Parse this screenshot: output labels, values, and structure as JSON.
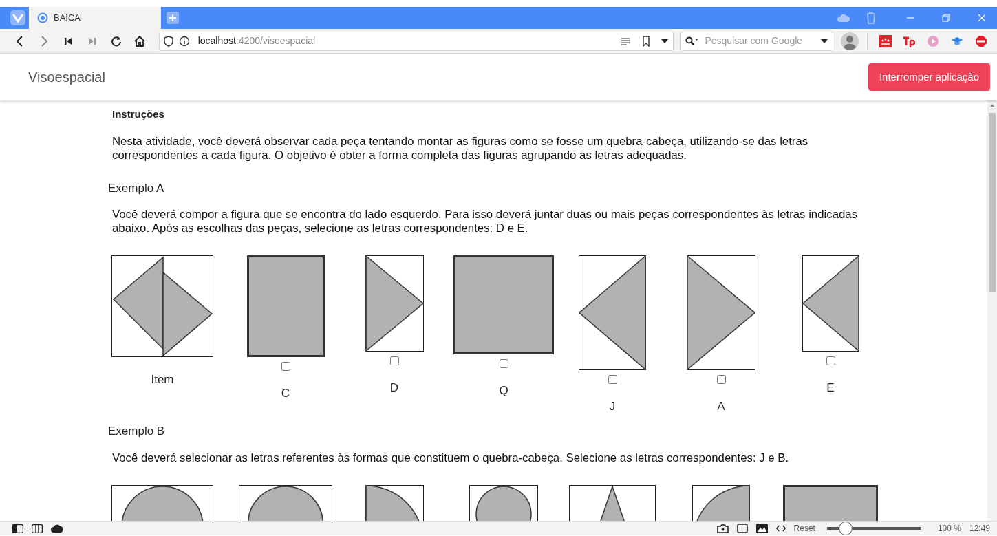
{
  "browser": {
    "tab": {
      "title": "BAICA",
      "selected": true
    },
    "address": {
      "host": "localhost",
      "path": ":4200/visoespacial"
    },
    "search": {
      "placeholder": "Pesquisar com Google"
    }
  },
  "app": {
    "title": "Visoespacial",
    "button": "Interromper aplicação"
  },
  "instructions": {
    "heading": "Instruções",
    "text": "Nesta atividade, você deverá observar cada peça tentando montar as figuras como se fosse um quebra-cabeça, utilizando-se das letras correspondentes a cada figura. O objetivo é obter a forma completa das figuras agrupando as letras adequadas."
  },
  "examples": [
    {
      "title": "Exemplo A",
      "text": "Você deverá compor a figura que se encontra do lado esquerdo. Para isso deverá juntar duas ou mais peças correspondentes às letras indicadas abaixo. Após as escolhas das peças, selecione as letras correspondentes: D e E.",
      "figure": {
        "label": "Item",
        "kind": "diamond-pair"
      },
      "pieces": [
        {
          "letter": "C",
          "kind": "rect",
          "checked": false
        },
        {
          "letter": "D",
          "kind": "tri-right",
          "checked": false
        },
        {
          "letter": "Q",
          "kind": "rect",
          "checked": false
        },
        {
          "letter": "J",
          "kind": "tri-left",
          "checked": false
        },
        {
          "letter": "A",
          "kind": "tri-right",
          "checked": false
        },
        {
          "letter": "E",
          "kind": "tri-left",
          "checked": false
        }
      ]
    },
    {
      "title": "Exemplo B",
      "text": "Você deverá selecionar as letras referentes às formas que constituem o quebra-cabeça. Selecione as letras correspondentes: J e B.",
      "figure": {
        "kind": "dome"
      },
      "pieces": [
        {
          "kind": "dome"
        },
        {
          "kind": "quarter-right"
        },
        {
          "kind": "dome"
        },
        {
          "kind": "spike"
        },
        {
          "kind": "quarter-left"
        },
        {
          "kind": "rect"
        }
      ]
    }
  ],
  "status_bar": {
    "reset": "Reset",
    "zoom": {
      "level": 0.2
    },
    "zoom_reading": "100 %",
    "time": "12:49"
  }
}
